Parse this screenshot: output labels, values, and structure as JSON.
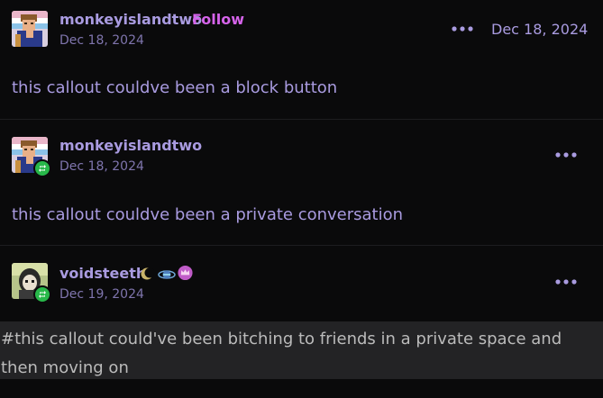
{
  "posts": [
    {
      "username": "monkeyislandtwo",
      "follow_label": "Follow",
      "date": "Dec 18, 2024",
      "date_right": "Dec 18, 2024",
      "body": "this callout couldve been a block button",
      "reblogged": false
    },
    {
      "username": "monkeyislandtwo",
      "date": "Dec 18, 2024",
      "body": "this callout couldve been a private conversation",
      "reblogged": true
    },
    {
      "username": "voidsteeth",
      "date": "Dec 19, 2024",
      "body": "#this callout could've been bitching to friends in a private space and then moving on",
      "reblogged": true,
      "badges": [
        "moon-badge-icon",
        "planet-badge-icon",
        "crown-badge-icon"
      ]
    }
  ],
  "icons": {
    "more_options": "more-options-icon",
    "reblog": "reblog-icon"
  },
  "colors": {
    "background": "#0a0a0b",
    "username": "#a99be0",
    "follow": "#d563ea",
    "date": "#7f75ad",
    "reblog_badge": "#28b84a",
    "quote_background": "#232325",
    "quote_text": "#bbbbbb"
  }
}
